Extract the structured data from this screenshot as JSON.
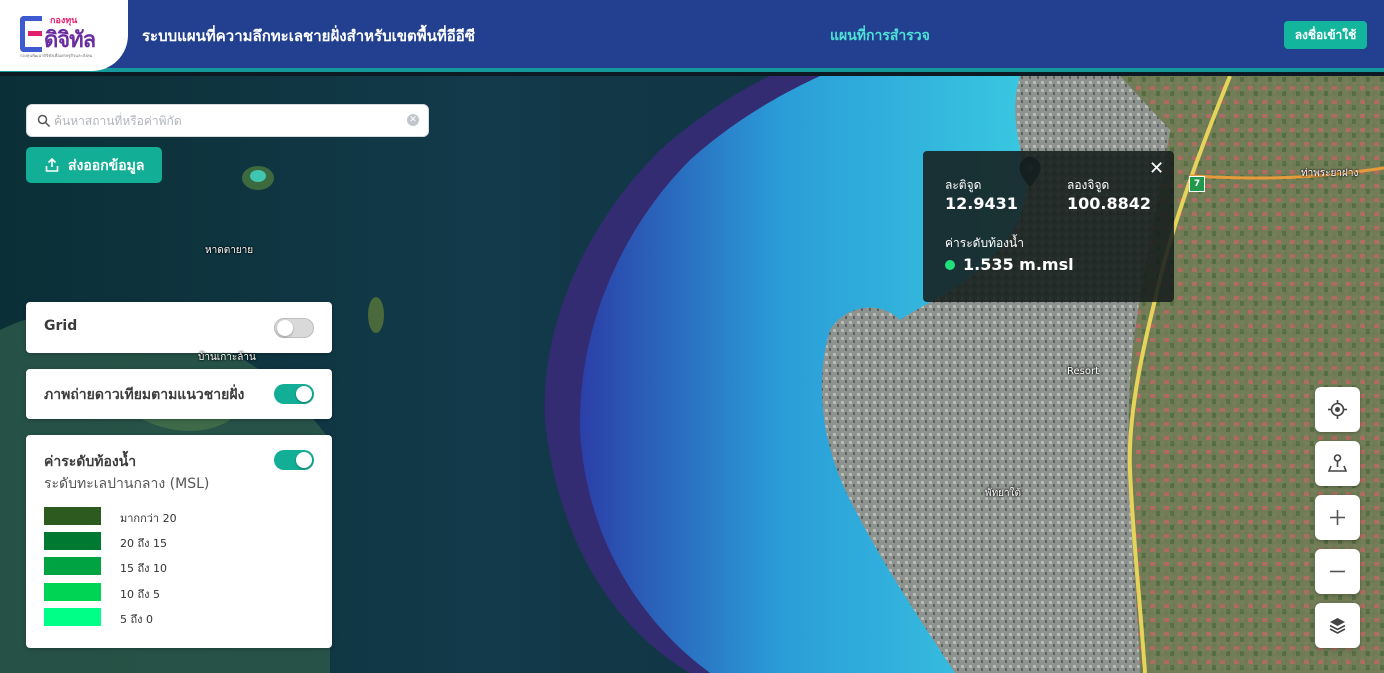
{
  "header": {
    "logo_top": "กองทุน",
    "logo_name": "ดิจิทัล",
    "logo_sub": "กองทุนพัฒนาดิจิทัลเพื่อเศรษฐกิจและสังคม",
    "title": "ระบบแผนที่ความลึกทะเลชายฝั่งสำหรับเขตพื้นที่อีอีซี",
    "nav_survey": "แผนที่การสำรวจ",
    "login": "ลงชื่อเข้าใช้"
  },
  "search": {
    "placeholder": "ค้นหาสถานที่หรือค่าพิกัด",
    "icon": "search-icon",
    "clear_icon": "clear-icon",
    "clear_glyph": "✕"
  },
  "export_button": {
    "label": "ส่งออกข้อมูล",
    "icon": "upload-icon"
  },
  "layers": {
    "grid": {
      "label": "Grid",
      "enabled": false
    },
    "satellite": {
      "label": "ภาพถ่ายดาวเทียมตามแนวชายฝั่ง",
      "enabled": true
    },
    "depth": {
      "label": "ค่าระดับท้องน้ำ",
      "subtitle": "ระดับทะเลปานกลาง (MSL)",
      "enabled": true,
      "legend": [
        {
          "label": "มากกว่า 20",
          "color": "#2d5a1f"
        },
        {
          "label": "20 ถึง 15",
          "color": "#007a33"
        },
        {
          "label": "15 ถึง 10",
          "color": "#00a341"
        },
        {
          "label": "10 ถึง 5",
          "color": "#00d455"
        },
        {
          "label": "5 ถึง 0",
          "color": "#00ff86"
        }
      ]
    }
  },
  "popup": {
    "lat_label": "ละติจูด",
    "lat_value": "12.9431",
    "lon_label": "ลองจิจูด",
    "lon_value": "100.8842",
    "depth_label": "ค่าระดับท้องน้ำ",
    "depth_value": "1.535 m.msl",
    "close_glyph": "✕"
  },
  "map_labels": {
    "place_1": "หาดตายาย",
    "place_2": "บ้านเกาะล้าน",
    "place_3": "Resort",
    "place_4": "พัทยาใต้",
    "place_5": "ท่าพระยาฝาง",
    "road_number": "7"
  },
  "map_controls": [
    "locate-icon",
    "marker-pin-icon",
    "zoom-in-icon",
    "zoom-out-icon",
    "layers-icon"
  ],
  "colors": {
    "header_bg": "#22408f",
    "accent": "#13b59c",
    "nav_highlight": "#4fe0d6",
    "depth_dot": "#1fe07a"
  }
}
